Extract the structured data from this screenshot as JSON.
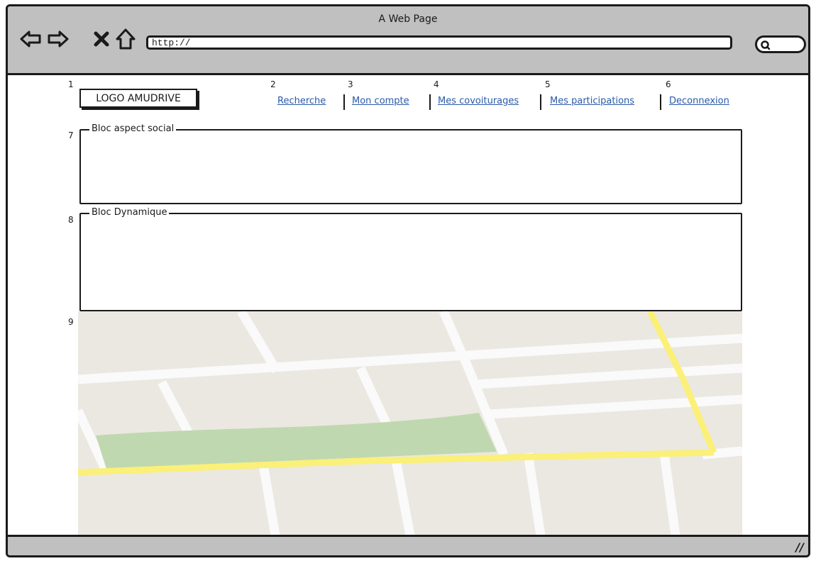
{
  "browser": {
    "title": "A Web Page",
    "url": "http://",
    "nav_icons": [
      "back-arrow-icon",
      "forward-arrow-icon",
      "stop-icon",
      "home-icon"
    ],
    "search_icon": "search-icon"
  },
  "page": {
    "logo": {
      "number": "1",
      "label": "LOGO AMUDRIVE"
    },
    "nav": [
      {
        "number": "2",
        "label": "Recherche"
      },
      {
        "number": "3",
        "label": "Mon compte"
      },
      {
        "number": "4",
        "label": "Mes covoiturages"
      },
      {
        "number": "5",
        "label": "Mes participations"
      },
      {
        "number": "6",
        "label": "Deconnexion"
      }
    ],
    "blocs": [
      {
        "number": "7",
        "label": "Bloc aspect social"
      },
      {
        "number": "8",
        "label": "Bloc Dynamique"
      }
    ],
    "map": {
      "number": "9"
    }
  },
  "colors": {
    "chrome": "#c0c0c0",
    "link": "#2a5aa8",
    "map_bg": "#ebe8e1",
    "map_road": "#fafafa",
    "map_highway": "#fbf078",
    "map_park": "#c0d8b0"
  }
}
